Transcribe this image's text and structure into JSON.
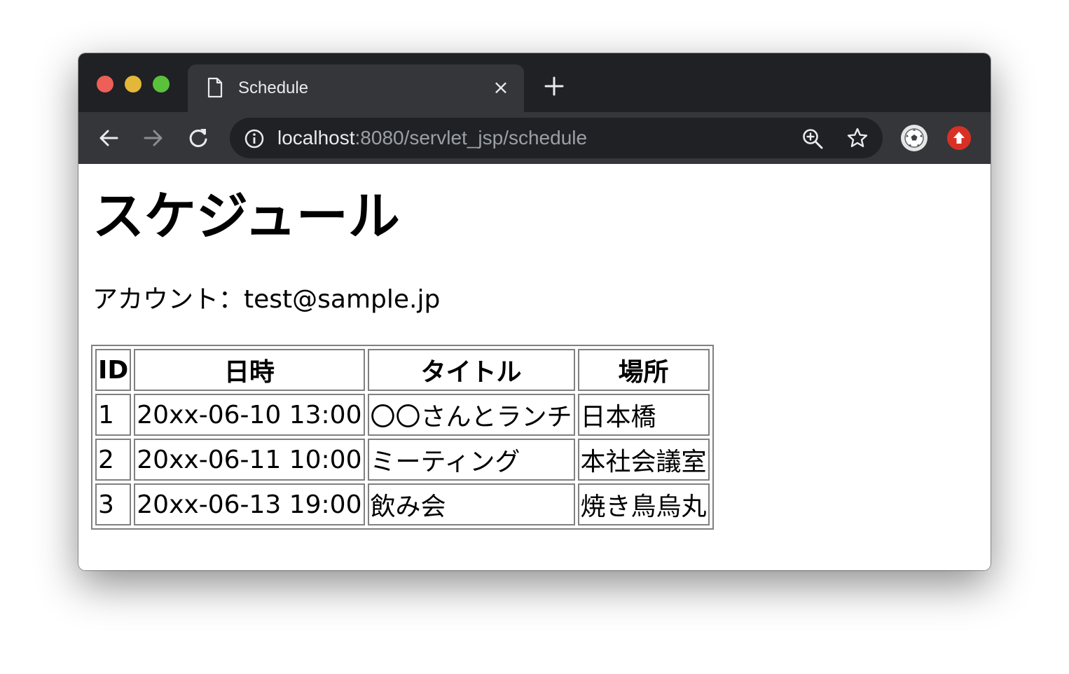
{
  "browser": {
    "tab_title": "Schedule",
    "tab_close": "×",
    "url_host": "localhost",
    "url_rest": ":8080/servlet_jsp/schedule"
  },
  "page": {
    "heading": "スケジュール",
    "account_line": "アカウント：test@sample.jp"
  },
  "table": {
    "headers": [
      "ID",
      "日時",
      "タイトル",
      "場所"
    ],
    "rows": [
      [
        "1",
        "20xx-06-10 13:00",
        "〇〇さんとランチ",
        "日本橋"
      ],
      [
        "2",
        "20xx-06-11 10:00",
        "ミーティング",
        "本社会議室"
      ],
      [
        "3",
        "20xx-06-13 19:00",
        "飲み会",
        "焼き鳥烏丸"
      ]
    ]
  },
  "colors": {
    "tabstrip": "#202124",
    "toolbar": "#35363a",
    "close": "#ed5f57",
    "minimize": "#e3b839",
    "maximize": "#5ac13b",
    "extension_red": "#d93025"
  }
}
